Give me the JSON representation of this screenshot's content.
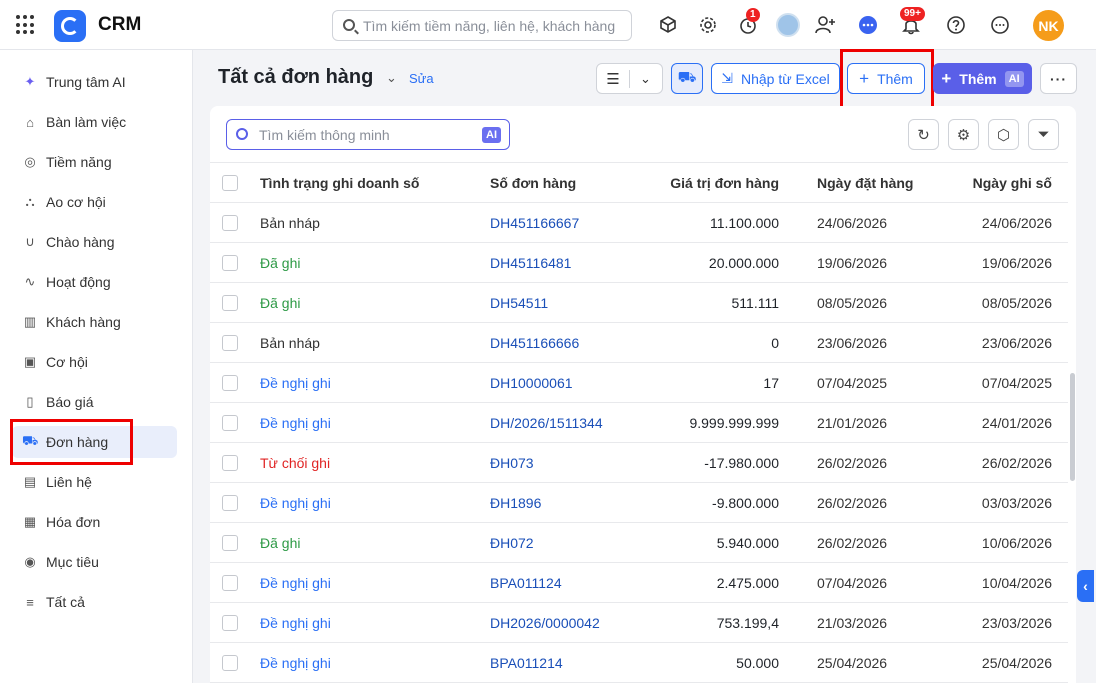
{
  "app": {
    "name": "CRM",
    "search_placeholder": "Tìm kiếm tiềm năng, liên hệ, khách hàng",
    "timer_badge": "1",
    "notif_badge": "99+",
    "user_initials": "NK"
  },
  "sidebar": {
    "items": [
      {
        "label": "Trung tâm AI",
        "icon": "sparkle-icon"
      },
      {
        "label": "Bàn làm việc",
        "icon": "home-icon"
      },
      {
        "label": "Tiềm năng",
        "icon": "target-icon"
      },
      {
        "label": "Ao cơ hội",
        "icon": "pool-icon"
      },
      {
        "label": "Chào hàng",
        "icon": "magnet-icon"
      },
      {
        "label": "Hoạt động",
        "icon": "pulse-icon"
      },
      {
        "label": "Khách hàng",
        "icon": "building-icon"
      },
      {
        "label": "Cơ hội",
        "icon": "briefcase-icon"
      },
      {
        "label": "Báo giá",
        "icon": "quote-icon"
      },
      {
        "label": "Đơn hàng",
        "icon": "cart-icon"
      },
      {
        "label": "Liên hệ",
        "icon": "contact-icon"
      },
      {
        "label": "Hóa đơn",
        "icon": "invoice-icon"
      },
      {
        "label": "Mục tiêu",
        "icon": "goal-icon"
      },
      {
        "label": "Tất cả",
        "icon": "menu-icon"
      }
    ],
    "active_label": "Đơn hàng"
  },
  "header": {
    "title": "Tất cả đơn hàng",
    "edit_label": "Sửa",
    "import_label": "Nhập từ Excel",
    "add_label": "Thêm",
    "add_ai_label": "Thêm",
    "ai_tag": "AI"
  },
  "toolbar": {
    "smart_search_placeholder": "Tìm kiếm thông minh",
    "ai_tag": "AI"
  },
  "table": {
    "columns": [
      "Tình trạng ghi doanh số",
      "Số đơn hàng",
      "Giá trị đơn hàng",
      "Ngày đặt hàng",
      "Ngày ghi số"
    ],
    "rows": [
      {
        "status": "Bản nháp",
        "status_type": "draft",
        "order_no": "DH451166667",
        "value": "11.100.000",
        "order_date": "24/06/2026",
        "record_date": "24/06/2026"
      },
      {
        "status": "Đã ghi",
        "status_type": "done",
        "order_no": "DH45116481",
        "value": "20.000.000",
        "order_date": "19/06/2026",
        "record_date": "19/06/2026"
      },
      {
        "status": "Đã ghi",
        "status_type": "done",
        "order_no": "DH54511",
        "value": "511.111",
        "order_date": "08/05/2026",
        "record_date": "08/05/2026"
      },
      {
        "status": "Bản nháp",
        "status_type": "draft",
        "order_no": "DH451166666",
        "value": "0",
        "order_date": "23/06/2026",
        "record_date": "23/06/2026"
      },
      {
        "status": "Đề nghị ghi",
        "status_type": "suggest",
        "order_no": "DH10000061",
        "value": "17",
        "order_date": "07/04/2025",
        "record_date": "07/04/2025"
      },
      {
        "status": "Đề nghị ghi",
        "status_type": "suggest",
        "order_no": "DH/2026/1511344",
        "value": "9.999.999.999",
        "order_date": "21/01/2026",
        "record_date": "24/01/2026"
      },
      {
        "status": "Từ chối ghi",
        "status_type": "reject",
        "order_no": "ĐH073",
        "value": "-17.980.000",
        "order_date": "26/02/2026",
        "record_date": "26/02/2026"
      },
      {
        "status": "Đề nghị ghi",
        "status_type": "suggest",
        "order_no": "ĐH1896",
        "value": "-9.800.000",
        "order_date": "26/02/2026",
        "record_date": "03/03/2026"
      },
      {
        "status": "Đã ghi",
        "status_type": "done",
        "order_no": "ĐH072",
        "value": "5.940.000",
        "order_date": "26/02/2026",
        "record_date": "10/06/2026"
      },
      {
        "status": "Đề nghị ghi",
        "status_type": "suggest",
        "order_no": "BPA011124",
        "value": "2.475.000",
        "order_date": "07/04/2026",
        "record_date": "10/04/2026"
      },
      {
        "status": "Đề nghị ghi",
        "status_type": "suggest",
        "order_no": "DH2026/0000042",
        "value": "753.199,4",
        "order_date": "21/03/2026",
        "record_date": "23/03/2026"
      },
      {
        "status": "Đề nghị ghi",
        "status_type": "suggest",
        "order_no": "BPA011214",
        "value": "50.000",
        "order_date": "25/04/2026",
        "record_date": "25/04/2026"
      }
    ]
  }
}
